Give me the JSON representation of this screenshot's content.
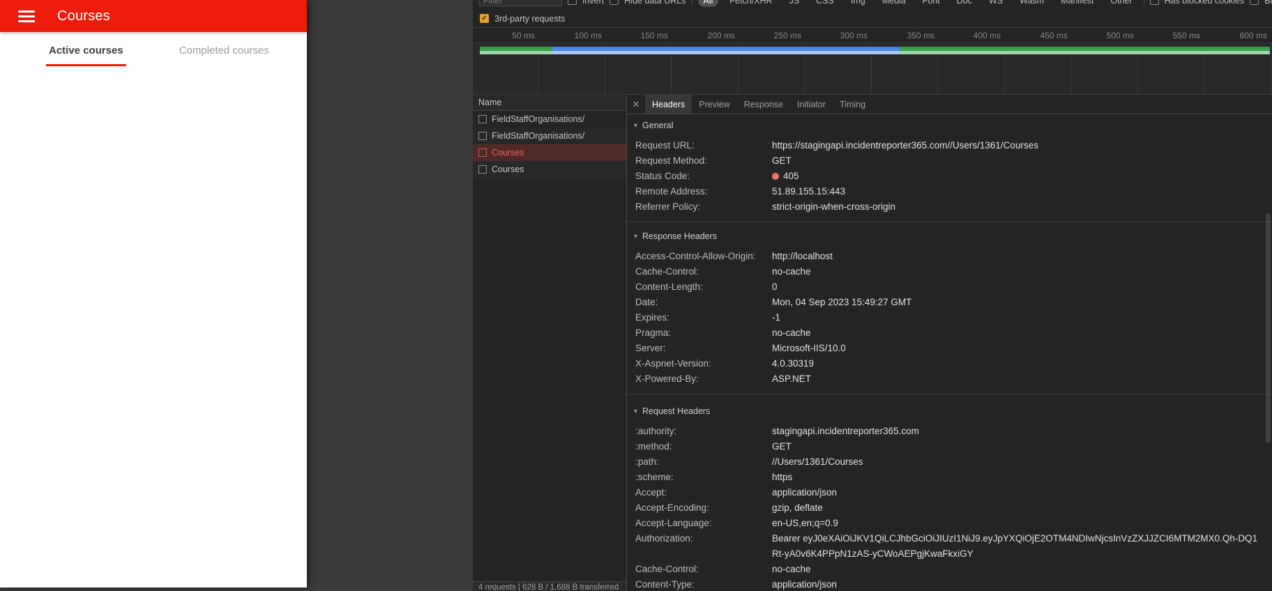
{
  "app": {
    "title": "Courses",
    "tabs": [
      {
        "label": "Active courses",
        "active": true
      },
      {
        "label": "Completed courses",
        "active": false
      }
    ]
  },
  "devtools": {
    "icons": {
      "close": "✕",
      "disclosure": "▾",
      "check": "✓"
    },
    "filter_bar": {
      "placeholder": "Filter",
      "invert": "Invert",
      "hide_data_urls": "Hide data URLs",
      "types": [
        "All",
        "Fetch/XHR",
        "JS",
        "CSS",
        "Img",
        "Media",
        "Font",
        "Doc",
        "WS",
        "Wasm",
        "Manifest",
        "Other"
      ],
      "active_type": "All",
      "has_blocked_cookies": "Has blocked cookies",
      "blocked_requests": "Blocked Requests",
      "third_party": "3rd-party requests"
    },
    "timeline": {
      "ticks": [
        "50 ms",
        "100 ms",
        "150 ms",
        "200 ms",
        "250 ms",
        "300 ms",
        "350 ms",
        "400 ms",
        "450 ms",
        "500 ms",
        "550 ms",
        "600 ms"
      ]
    },
    "requests": {
      "name_header": "Name",
      "rows": [
        {
          "name": "FieldStaffOrganisations/",
          "status": "ok",
          "selected": false
        },
        {
          "name": "FieldStaffOrganisations/",
          "status": "ok",
          "selected": false
        },
        {
          "name": "Courses",
          "status": "error",
          "selected": true
        },
        {
          "name": "Courses",
          "status": "ok",
          "selected": false
        }
      ]
    },
    "details": {
      "tabs": [
        "Headers",
        "Preview",
        "Response",
        "Initiator",
        "Timing"
      ],
      "active_tab": "Headers",
      "general": {
        "title": "General",
        "rows": [
          [
            "Request URL:",
            "https://stagingapi.incidentreporter365.com//Users/1361/Courses"
          ],
          [
            "Request Method:",
            "GET"
          ],
          [
            "Status Code:",
            "405"
          ],
          [
            "Remote Address:",
            "51.89.155.15:443"
          ],
          [
            "Referrer Policy:",
            "strict-origin-when-cross-origin"
          ]
        ]
      },
      "response_headers": {
        "title": "Response Headers",
        "rows": [
          [
            "Access-Control-Allow-Origin:",
            "http://localhost"
          ],
          [
            "Cache-Control:",
            "no-cache"
          ],
          [
            "Content-Length:",
            "0"
          ],
          [
            "Date:",
            "Mon, 04 Sep 2023 15:49:27 GMT"
          ],
          [
            "Expires:",
            "-1"
          ],
          [
            "Pragma:",
            "no-cache"
          ],
          [
            "Server:",
            "Microsoft-IIS/10.0"
          ],
          [
            "X-Aspnet-Version:",
            "4.0.30319"
          ],
          [
            "X-Powered-By:",
            "ASP.NET"
          ]
        ]
      },
      "request_headers": {
        "title": "Request Headers",
        "rows": [
          [
            ":authority:",
            "stagingapi.incidentreporter365.com"
          ],
          [
            ":method:",
            "GET"
          ],
          [
            ":path:",
            "//Users/1361/Courses"
          ],
          [
            ":scheme:",
            "https"
          ],
          [
            "Accept:",
            "application/json"
          ],
          [
            "Accept-Encoding:",
            "gzip, deflate"
          ],
          [
            "Accept-Language:",
            "en-US,en;q=0.9"
          ],
          [
            "Authorization:",
            "Bearer eyJ0eXAiOiJKV1QiLCJhbGciOiJIUzI1NiJ9.eyJpYXQiOjE2OTM4NDIwNjcsInVzZXJJZCI6MTM2MX0.Qh-DQ1Rt-yA0v6K4PPpN1zAS-yCWoAEPgjKwaFkxiGY"
          ],
          [
            "Cache-Control:",
            "no-cache"
          ],
          [
            "Content-Type:",
            "application/json"
          ]
        ]
      }
    },
    "status_bar": {
      "text": "4 requests | 628 B / 1,688 B transferred"
    },
    "colors": {
      "app_accent_red": "#ee1c0c",
      "error_text": "#e46962",
      "selected_row_bg": "#512a28",
      "status_dot": "#e9756b",
      "third_party_checkbox": "#dfa32e",
      "overview_green": "#3a9d4e",
      "overview_blue": "#4a86e8"
    }
  }
}
